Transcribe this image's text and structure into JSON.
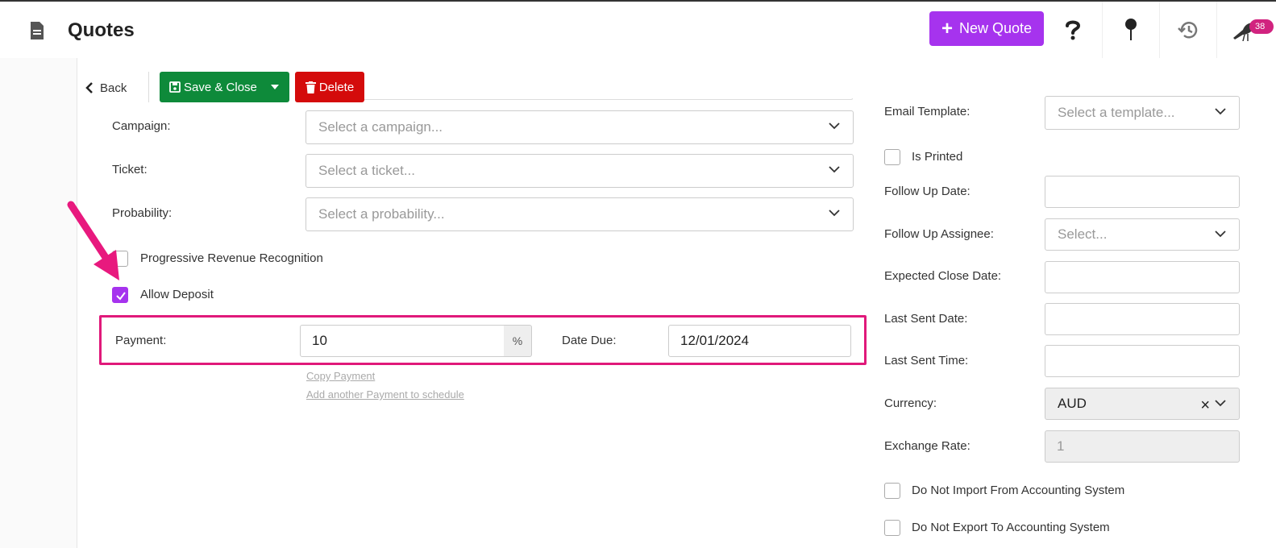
{
  "header": {
    "title": "Quotes",
    "new_quote_label": "New Quote",
    "notification_count": "38",
    "accent_color": "#a633ee"
  },
  "toolbar": {
    "back_label": "Back",
    "save_label": "Save & Close",
    "delete_label": "Delete"
  },
  "left_form": {
    "campaign_label": "Campaign:",
    "campaign_placeholder": "Select a campaign...",
    "ticket_label": "Ticket:",
    "ticket_placeholder": "Select a ticket...",
    "probability_label": "Probability:",
    "probability_placeholder": "Select a probability...",
    "progressive_label": "Progressive Revenue Recognition",
    "progressive_checked": false,
    "allow_deposit_label": "Allow Deposit",
    "allow_deposit_checked": true,
    "payment_label": "Payment:",
    "payment_value": "10",
    "payment_unit": "%",
    "date_due_label": "Date Due:",
    "date_due_value": "12/01/2024",
    "copy_payment_label": "Copy Payment",
    "add_payment_label": "Add another Payment to schedule"
  },
  "right_form": {
    "email_template_label": "Email Template:",
    "email_template_placeholder": "Select a template...",
    "is_printed_label": "Is Printed",
    "follow_up_date_label": "Follow Up Date:",
    "follow_up_assignee_label": "Follow Up Assignee:",
    "follow_up_assignee_placeholder": "Select...",
    "expected_close_label": "Expected Close Date:",
    "last_sent_date_label": "Last Sent Date:",
    "last_sent_time_label": "Last Sent Time:",
    "currency_label": "Currency:",
    "currency_value": "AUD",
    "exchange_rate_label": "Exchange Rate:",
    "exchange_rate_value": "1",
    "no_import_label": "Do Not Import From Accounting System",
    "no_export_label": "Do Not Export To Accounting System"
  },
  "icons": [
    "document-icon",
    "plus-icon",
    "help-icon",
    "pin-icon",
    "history-icon",
    "bird-icon",
    "chevron-left-icon",
    "save-icon",
    "caret-down-icon",
    "trash-icon",
    "chevron-down-icon",
    "check-icon",
    "clear-icon",
    "arrow-annotation"
  ]
}
